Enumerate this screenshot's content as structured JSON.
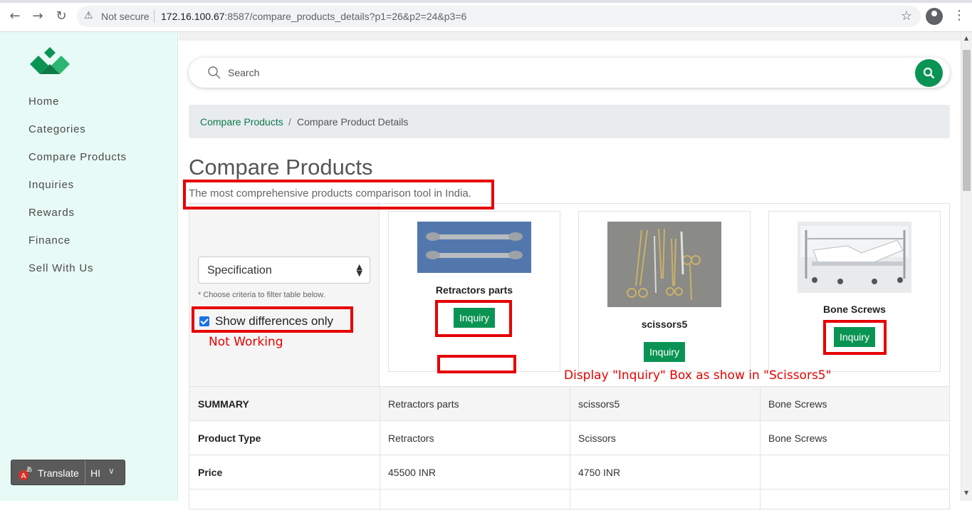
{
  "browser": {
    "security_label": "Not secure",
    "url_host": "172.16.100.67",
    "url_rest": ":8587/compare_products_details?p1=26&p2=24&p3=6"
  },
  "sidebar": {
    "items": [
      {
        "label": "Home"
      },
      {
        "label": "Categories"
      },
      {
        "label": "Compare Products"
      },
      {
        "label": "Inquiries"
      },
      {
        "label": "Rewards"
      },
      {
        "label": "Finance"
      },
      {
        "label": "Sell With Us"
      }
    ],
    "translate": {
      "label": "Translate",
      "lang": "HI"
    }
  },
  "search": {
    "placeholder": "Search"
  },
  "breadcrumb": {
    "items": [
      "Compare Products",
      "Compare Product Details"
    ],
    "separator": "/"
  },
  "page": {
    "title": "Compare Products",
    "subtitle": "The most comprehensive products comparison tool in India."
  },
  "filter": {
    "select_value": "Specification",
    "hint": "* Choose criteria to filter table below.",
    "show_differences_label": "Show differences only",
    "show_differences_checked": true
  },
  "products": [
    {
      "name": "Retractors parts",
      "button": "Inquiry"
    },
    {
      "name": "scissors5",
      "button": "Inquiry"
    },
    {
      "name": "Bone Screws",
      "button": "Inquiry"
    }
  ],
  "table": {
    "rows": [
      {
        "label": "SUMMARY",
        "values": [
          "Retractors parts",
          "scissors5",
          "Bone Screws"
        ]
      },
      {
        "label": "Product Type",
        "values": [
          "Retractors",
          "Scissors",
          "Bone Screws"
        ]
      },
      {
        "label": "Price",
        "values": [
          "45500 INR",
          "4750 INR",
          ""
        ]
      }
    ]
  },
  "annotations": {
    "not_working": "Not Working",
    "display_inquiry": "Display \"Inquiry\" Box as show in \"Scissors5\""
  },
  "colors": {
    "brand_green": "#0a9454",
    "annotation_red": "#e60000",
    "sidebar_bg": "#e8faf5"
  }
}
